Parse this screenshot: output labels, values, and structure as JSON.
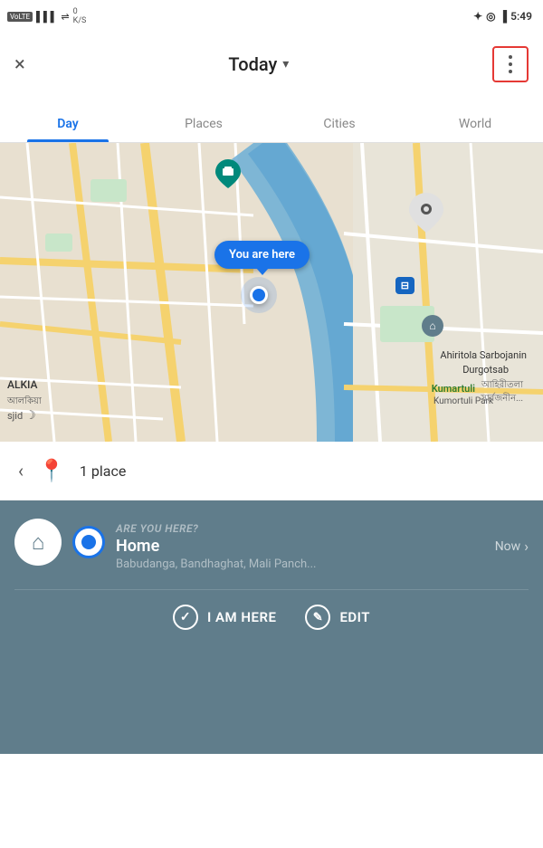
{
  "statusBar": {
    "volte": "VoLTE",
    "signal": "4G",
    "battery": "100",
    "time": "5:49",
    "bluetooth": "⊕",
    "location": "⊙"
  },
  "header": {
    "closeLabel": "×",
    "title": "Today",
    "titleArrow": "▾"
  },
  "tabs": [
    {
      "id": "day",
      "label": "Day",
      "active": true
    },
    {
      "id": "places",
      "label": "Places",
      "active": false
    },
    {
      "id": "cities",
      "label": "Cities",
      "active": false
    },
    {
      "id": "world",
      "label": "World",
      "active": false
    }
  ],
  "map": {
    "youAreHereLabel": "You are here",
    "alkiaLabel": "ALKIA",
    "alkiaBengaliLabel": "আলকিয়া",
    "kumartuliLabel": "Kumartuli",
    "kumartuliLabel2": "Kumortuli Park",
    "ahiritola1": "Ahiritola Sarbojanin",
    "ahiritola2": "Durgotsab",
    "ahiritola3": "আহিরীতলা",
    "ahiritola4": "সার্বজনীন...",
    "sjidLabel": "sjid"
  },
  "placeCount": {
    "count": "1 place"
  },
  "locationCard": {
    "question": "ARE YOU HERE?",
    "name": "Home",
    "time": "Now",
    "address": "Babudanga, Bandhaghat, Mali Panch...",
    "iAmHereLabel": "I AM HERE",
    "editLabel": "EDIT"
  }
}
